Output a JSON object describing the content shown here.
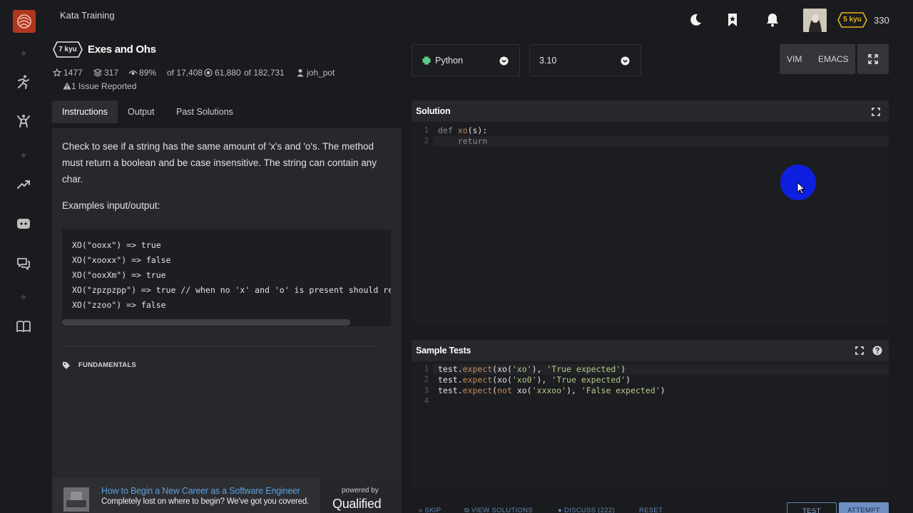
{
  "app": {
    "title": "Kata Training"
  },
  "user": {
    "rank": "5 kyu",
    "honor": "330"
  },
  "kata": {
    "rank": "7 kyu",
    "name": "Exes and Ohs",
    "check": "✓",
    "stats": {
      "stars": "1477",
      "collections": "317",
      "satisfaction_pct": "89%",
      "satisfaction_of": "of 17,408",
      "completed": "61,880",
      "completed_of": "of 182,731",
      "author": "joh_pot"
    },
    "issues": "1 Issue Reported",
    "tag": "FUNDAMENTALS"
  },
  "tabs": [
    "Instructions",
    "Output",
    "Past Solutions"
  ],
  "instructions": {
    "description": "Check to see if a string has the same amount of 'x's and 'o's. The method must return a boolean and be case insensitive. The string can contain any char.",
    "examples_title": "Examples input/output:",
    "examples": [
      "XO(\"ooxx\") => true",
      "XO(\"xooxx\") => false",
      "XO(\"ooxXm\") => true",
      "XO(\"zpzpzpp\") => true // when no 'x' and 'o' is present should return true",
      "XO(\"zzoo\") => false"
    ]
  },
  "promo": {
    "title": "How to Begin a New Career as a Software Engineer",
    "subtitle": "Completely lost on where to begin? We've got you covered.",
    "powered_by": "powered by",
    "brand": "Qualified"
  },
  "editor": {
    "language": "Python",
    "version": "3.10",
    "modes": [
      "VIM",
      "EMACS"
    ],
    "solution_title": "Solution",
    "solution_lines": [
      "1",
      "2"
    ],
    "tests_title": "Sample Tests",
    "tests_lines": [
      "1",
      "2",
      "3",
      "4"
    ]
  },
  "footer": {
    "skip": "SKIP",
    "view_solutions": "VIEW SOLUTIONS",
    "discuss": "DISCUSS (222)",
    "reset": "RESET",
    "test": "TEST",
    "attempt": "ATTEMPT"
  },
  "colors": {
    "accent_red": "#b1361e",
    "link_blue": "#5fa0dc",
    "rank_yellow": "#e5b31f",
    "cursor_blue": "#0f1fe0"
  }
}
